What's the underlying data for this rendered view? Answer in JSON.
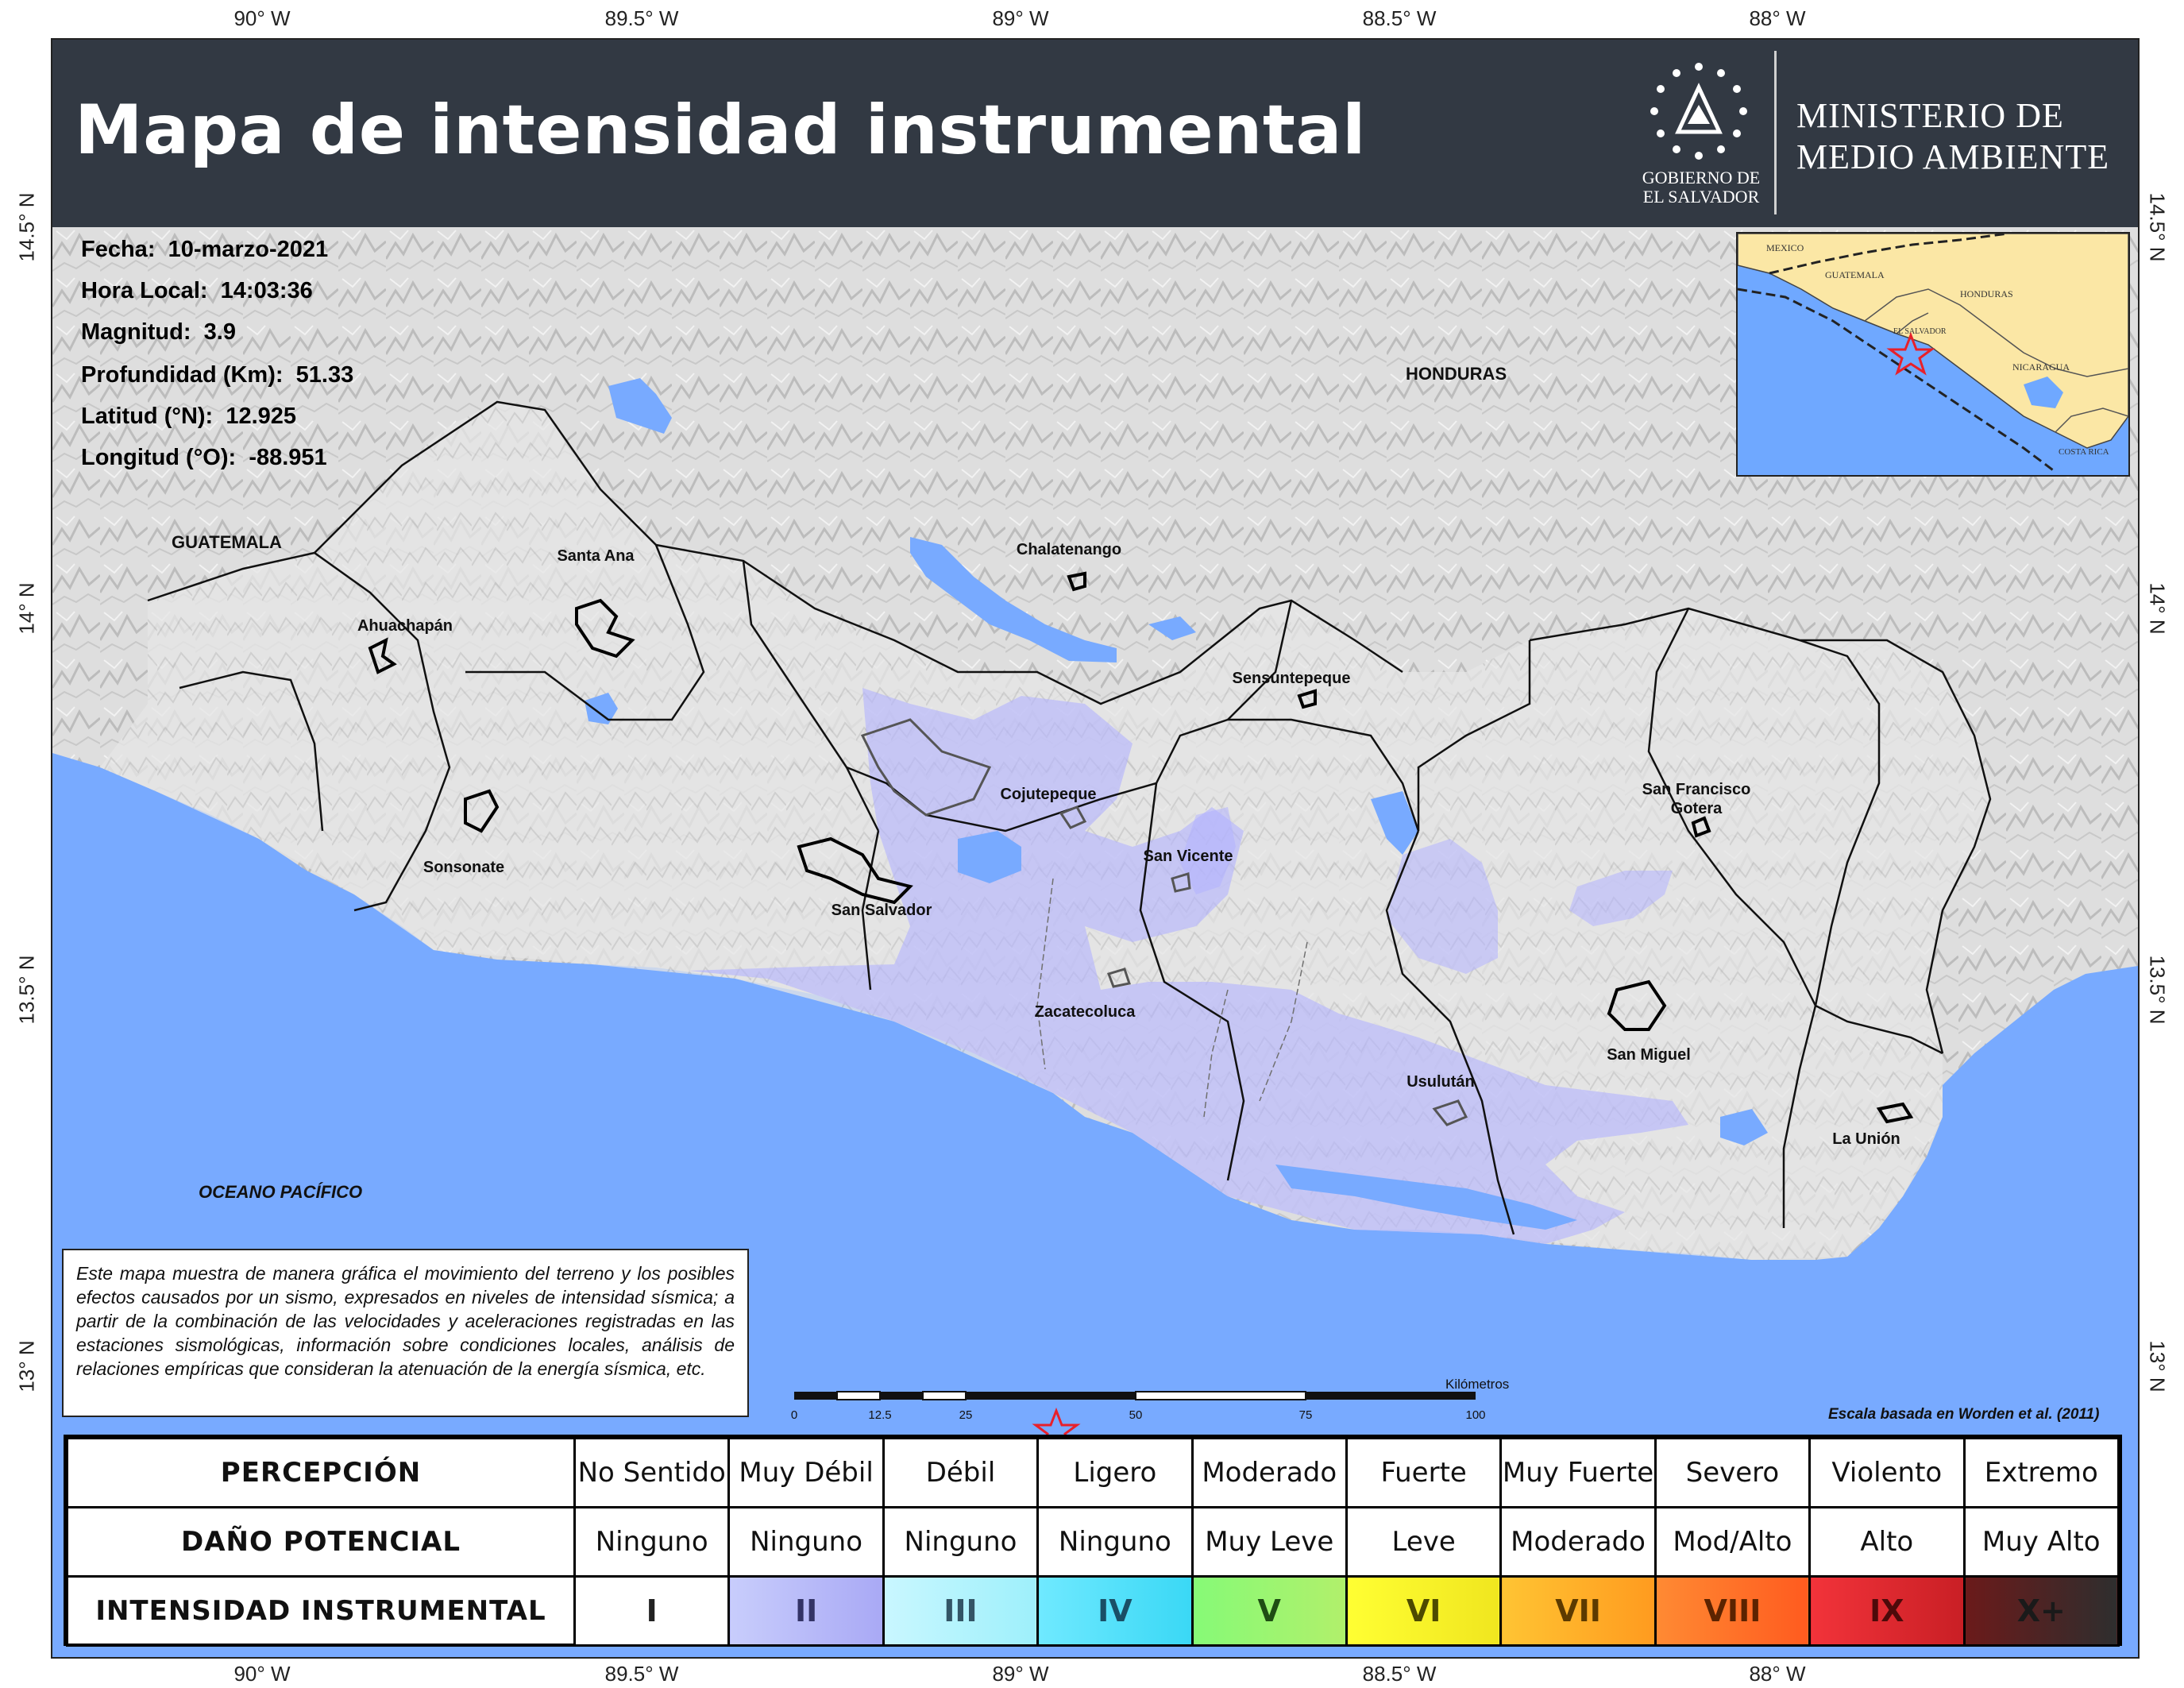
{
  "header": {
    "title": "Mapa de intensidad instrumental",
    "government_lines": [
      "GOBIERNO DE",
      "EL SALVADOR"
    ],
    "ministry_lines": [
      "MINISTERIO DE",
      "MEDIO AMBIENTE"
    ]
  },
  "graticule": {
    "longitude_labels": [
      "90° W",
      "89.5° W",
      "89° W",
      "88.5° W",
      "88° W"
    ],
    "latitude_labels": [
      "14.5° N",
      "14° N",
      "13.5° N",
      "13° N"
    ]
  },
  "event_info": {
    "fecha": {
      "label": "Fecha:",
      "value": "10-marzo-2021"
    },
    "hora": {
      "label": "Hora Local:",
      "value": "14:03:36"
    },
    "magnitud": {
      "label": "Magnitud:",
      "value": "3.9"
    },
    "profundidad": {
      "label": "Profundidad (Km):",
      "value": "51.33"
    },
    "latitud": {
      "label": "Latitud (°N):",
      "value": "12.925"
    },
    "longitud": {
      "label": "Longitud (°O):",
      "value": "-88.951"
    }
  },
  "places": {
    "ahuachapan": "Ahuachapán",
    "santa_ana": "Santa Ana",
    "sonsonate": "Sonsonate",
    "chalatenango": "Chalatenango",
    "san_salvador": "San Salvador",
    "cojutepeque": "Cojutepeque",
    "sensuntepeque": "Sensuntepeque",
    "san_vicente": "San Vicente",
    "zacatecoluca": "Zacatecoluca",
    "usulutan": "Usulután",
    "san_francisco_gotera_1": "San Francisco",
    "san_francisco_gotera_2": "Gotera",
    "san_miguel": "San Miguel",
    "la_union": "La Unión"
  },
  "countries": {
    "guatemala": "GUATEMALA",
    "honduras": "HONDURAS"
  },
  "ocean": "OCEANO PACÍFICO",
  "inset": {
    "mexico": "MEXICO",
    "guatemala": "GUATEMALA",
    "honduras": "HONDURAS",
    "el_salvador": "EL SALVADOR",
    "nicaragua": "NICARAGUA",
    "costa_rica": "COSTA RICA"
  },
  "note": "Este mapa muestra de manera gráfica el movimiento del terreno y los posibles efectos causados por un sismo, expresados en niveles de intensidad sísmica; a partir de la combinación de las velocidades y aceleraciones registradas en las estaciones sismológicas, información sobre condiciones locales, análisis de relaciones empíricas que consideran la atenuación de la energía sísmica, etc.",
  "scale": {
    "unit": "Kilómetros",
    "ticks": [
      "0",
      "12.5",
      "25",
      "50",
      "75",
      "100"
    ]
  },
  "source_credit": "Escala basada en Worden et al. (2011)",
  "legend": {
    "row_headers": [
      "PERCEPCIÓN",
      "DAÑO POTENCIAL",
      "INTENSIDAD INSTRUMENTAL"
    ],
    "levels": [
      {
        "perception": "No Sentido",
        "damage": "Ninguno",
        "intensity": "I",
        "color_start": "#ffffff",
        "color_end": "#ffffff",
        "text_color": "#222222"
      },
      {
        "perception": "Muy Débil",
        "damage": "Ninguno",
        "intensity": "II",
        "color_start": "#c8cdfc",
        "color_end": "#a9a9f5",
        "text_color": "#333366"
      },
      {
        "perception": "Débil",
        "damage": "Ninguno",
        "intensity": "III",
        "color_start": "#c9f7ff",
        "color_end": "#9ef0fb",
        "text_color": "#335566"
      },
      {
        "perception": "Ligero",
        "damage": "Ninguno",
        "intensity": "IV",
        "color_start": "#6fe9ff",
        "color_end": "#3ad8f5",
        "text_color": "#1a4f66"
      },
      {
        "perception": "Moderado",
        "damage": "Muy Leve",
        "intensity": "V",
        "color_start": "#86fa77",
        "color_end": "#b1f06b",
        "text_color": "#1f4d14"
      },
      {
        "perception": "Fuerte",
        "damage": "Leve",
        "intensity": "VI",
        "color_start": "#ffff33",
        "color_end": "#f0e61f",
        "text_color": "#4d4a00"
      },
      {
        "perception": "Muy Fuerte",
        "damage": "Moderado",
        "intensity": "VII",
        "color_start": "#ffc433",
        "color_end": "#ff9b1f",
        "text_color": "#5c3a00"
      },
      {
        "perception": "Severo",
        "damage": "Mod/Alto",
        "intensity": "VIII",
        "color_start": "#ff8a33",
        "color_end": "#ff5b1f",
        "text_color": "#5c2300"
      },
      {
        "perception": "Violento",
        "damage": "Alto",
        "intensity": "IX",
        "color_start": "#f2333a",
        "color_end": "#c91f25",
        "text_color": "#4d0a0a"
      },
      {
        "perception": "Extremo",
        "damage": "Muy Alto",
        "intensity": "X+",
        "color_start": "#6b1a1a",
        "color_end": "#2e2e2e",
        "text_color": "#1a1a1a"
      }
    ]
  },
  "colors": {
    "header_bg": "#323943",
    "sea": "#78aaff",
    "land_terrain": "#d9d9d9",
    "intensity_II_overlay": "#b3b3ff",
    "inset_land": "#fbe7a5",
    "epicenter_star": "#e8202a"
  },
  "icons": {
    "seal": "el-salvador-seal-icon",
    "epicenter": "epicenter-star-icon"
  }
}
